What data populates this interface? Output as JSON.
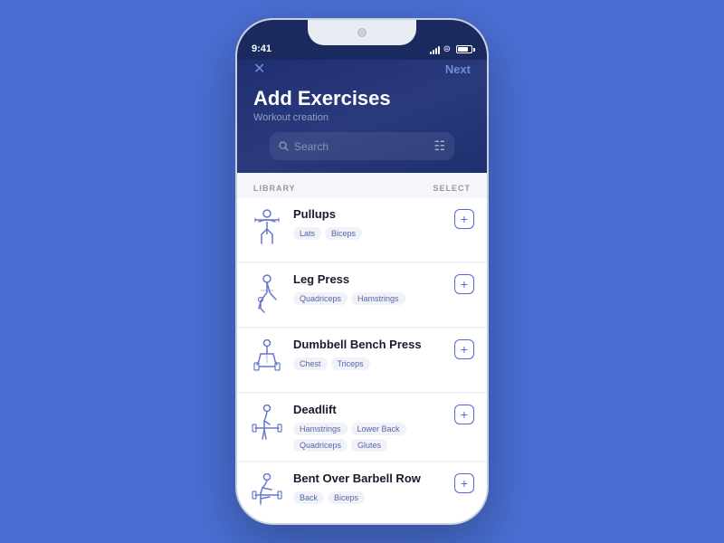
{
  "background_color": "#4a6fd4",
  "status_bar": {
    "time": "9:41",
    "signal_bars": [
      3,
      5,
      7,
      9,
      11
    ],
    "wifi": "WiFi",
    "battery_level": 70
  },
  "header": {
    "close_label": "✕",
    "next_label": "Next",
    "title": "Add Exercises",
    "subtitle": "Workout creation"
  },
  "search": {
    "placeholder": "Search",
    "filter_icon": "⚙"
  },
  "section_labels": {
    "library": "LIBRARY",
    "selected": "SELECT"
  },
  "exercises": [
    {
      "id": "pullups",
      "name": "Pullups",
      "tags": [
        "Lats",
        "Biceps"
      ],
      "icon_type": "pullup"
    },
    {
      "id": "leg-press",
      "name": "Leg Press",
      "tags": [
        "Quadriceps",
        "Hamstrings"
      ],
      "icon_type": "legpress"
    },
    {
      "id": "dumbbell-bench-press",
      "name": "Dumbbell Bench Press",
      "tags": [
        "Chest",
        "Triceps"
      ],
      "icon_type": "benchpress"
    },
    {
      "id": "deadlift",
      "name": "Deadlift",
      "tags": [
        "Hamstrings",
        "Lower Back",
        "Quadriceps",
        "Glutes"
      ],
      "icon_type": "deadlift"
    },
    {
      "id": "bent-over-barbell-row",
      "name": "Bent Over Barbell Row",
      "tags": [
        "Back",
        "Biceps"
      ],
      "icon_type": "barbellrow"
    }
  ],
  "add_button_label": "+"
}
